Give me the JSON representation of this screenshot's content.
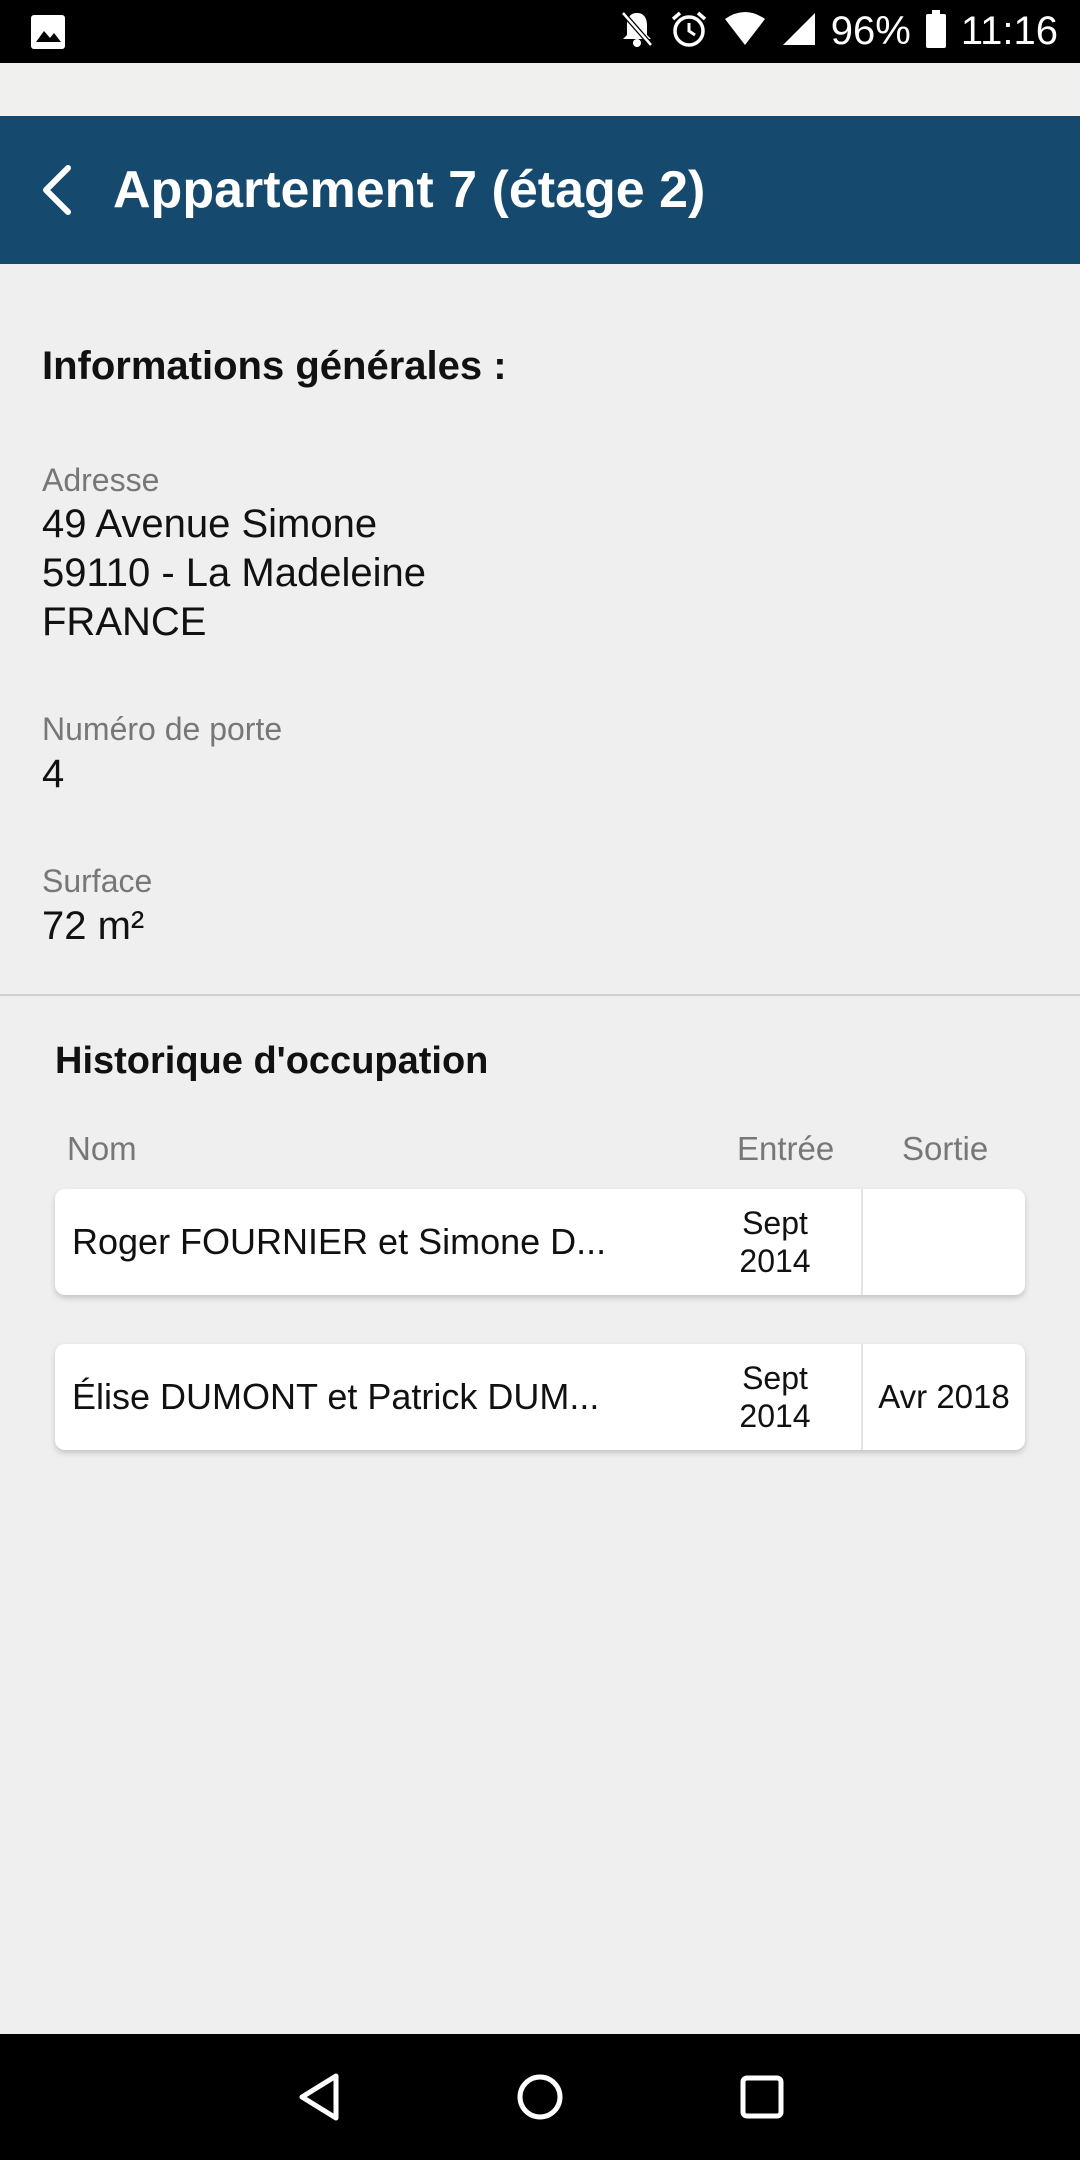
{
  "status_bar": {
    "battery": "96%",
    "time": "11:16",
    "icons": [
      "image-icon",
      "bell-off-icon",
      "alarm-icon",
      "wifi-icon",
      "signal-icon",
      "battery-icon"
    ]
  },
  "app_bar": {
    "title": "Appartement 7 (étage 2)",
    "color": "#154a6e"
  },
  "general_info": {
    "heading": "Informations générales :",
    "address_label": "Adresse",
    "address_lines": [
      "49 Avenue Simone",
      "59110 - La Madeleine",
      "FRANCE"
    ],
    "door_label": "Numéro de porte",
    "door_value": "4",
    "surface_label": "Surface",
    "surface_value": "72 m²"
  },
  "occupation": {
    "heading": "Historique d'occupation",
    "columns": {
      "name": "Nom",
      "entry": "Entrée",
      "exit": "Sortie"
    },
    "rows": [
      {
        "name": "Roger FOURNIER et Simone D...",
        "entry_month": "Sept",
        "entry_year": "2014",
        "exit": ""
      },
      {
        "name": "Élise DUMONT et Patrick DUM...",
        "entry_month": "Sept",
        "entry_year": "2014",
        "exit": "Avr 2018"
      }
    ]
  },
  "nav_bar": {
    "icons": [
      "back-triangle-icon",
      "home-circle-icon",
      "recents-square-icon"
    ]
  }
}
